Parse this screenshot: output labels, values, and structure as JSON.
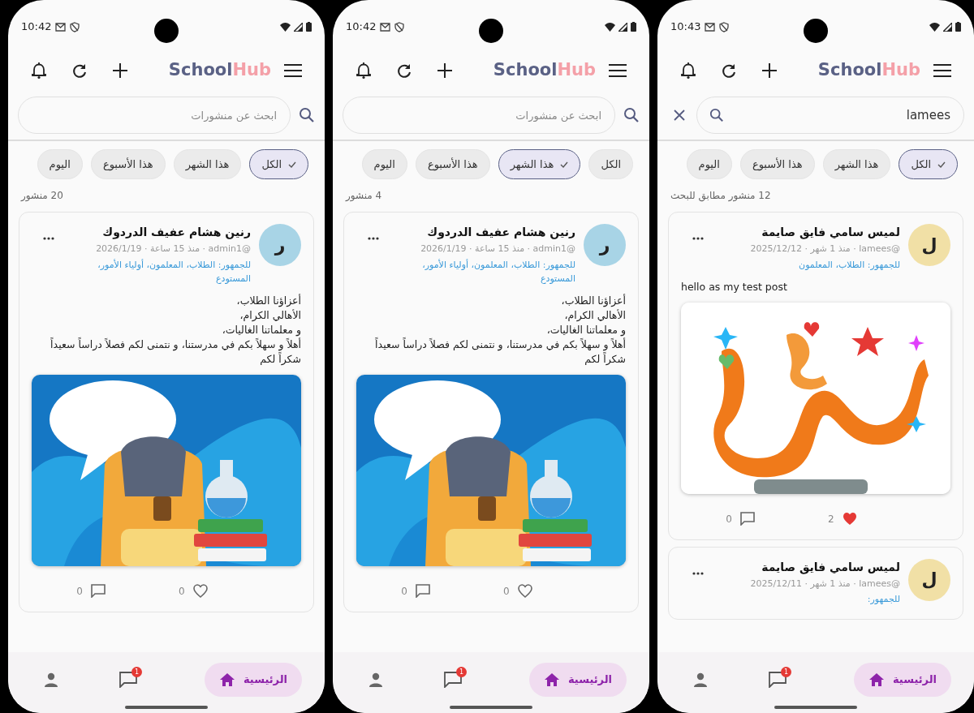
{
  "screens": [
    {
      "status": {
        "time": "10:43"
      },
      "logo": {
        "primary": "School",
        "accent": "Hub"
      },
      "search": {
        "kind": "active",
        "value": "lamees"
      },
      "filters": [
        {
          "label": "الكل",
          "selected": true
        },
        {
          "label": "هذا الشهر",
          "selected": false
        },
        {
          "label": "هذا الأسبوع",
          "selected": false
        },
        {
          "label": "اليوم",
          "selected": false
        }
      ],
      "count": "12 منشور مطابق للبحث",
      "posts": [
        {
          "avatar": "ل",
          "color": "#f1e0a6",
          "author": "لميس سامي فايق صايمة",
          "meta": "@lamees · منذ 1 شهر · 2025/12/12",
          "audience": "للجمهور: الطلاب، المعلمون",
          "body": "hello as my test post",
          "comments": "0",
          "likes": "2",
          "liked": true
        },
        {
          "avatar": "ل",
          "color": "#f1e0a6",
          "author": "لميس سامي فايق صايمة",
          "meta": "@lamees · منذ 1 شهر · 2025/12/11",
          "audience": "للجمهور:"
        }
      ],
      "nav": [
        {
          "kind": "home",
          "label": "الرئيسية",
          "selected": true
        },
        {
          "kind": "chat",
          "badge": "1",
          "selected": false
        },
        {
          "kind": "profile",
          "selected": false
        }
      ]
    },
    {
      "status": {
        "time": "10:42"
      },
      "logo": {
        "primary": "School",
        "accent": "Hub"
      },
      "search": {
        "kind": "idle",
        "placeholder": "ابحث عن منشورات"
      },
      "filters": [
        {
          "label": "الكل",
          "selected": false
        },
        {
          "label": "هذا الشهر",
          "selected": true
        },
        {
          "label": "هذا الأسبوع",
          "selected": false
        },
        {
          "label": "اليوم",
          "selected": false
        }
      ],
      "count": "4 منشور",
      "posts": [
        {
          "avatar": "ر",
          "color": "#a8d4e6",
          "author": "رنين هشام عفيف الدردوك",
          "meta": "@admin1 · منذ 15 ساعة · 2026/1/19",
          "audience": "للجمهور: الطلاب، المعلمون، أولياء الأمور، المستودع",
          "body": "أعزاؤنا الطلاب،\nالأهالي الكرام،\nو معلماتنا الغاليات،\nأهلاً و سهلاً بكم في مدرستنا، و نتمنى لكم فصلاً دراساً سعيداً\nشكراً لكم",
          "comments": "0",
          "likes": "0",
          "liked": false
        }
      ],
      "nav": [
        {
          "kind": "home",
          "label": "الرئيسية",
          "selected": true
        },
        {
          "kind": "chat",
          "badge": "1",
          "selected": false
        },
        {
          "kind": "profile",
          "selected": false
        }
      ]
    },
    {
      "status": {
        "time": "10:42"
      },
      "logo": {
        "primary": "School",
        "accent": "Hub"
      },
      "search": {
        "kind": "idle",
        "placeholder": "ابحث عن منشورات"
      },
      "filters": [
        {
          "label": "الكل",
          "selected": true
        },
        {
          "label": "هذا الشهر",
          "selected": false
        },
        {
          "label": "هذا الأسبوع",
          "selected": false
        },
        {
          "label": "اليوم",
          "selected": false
        }
      ],
      "count": "20 منشور",
      "posts": [
        {
          "avatar": "ر",
          "color": "#a8d4e6",
          "author": "رنين هشام عفيف الدردوك",
          "meta": "@admin1 · منذ 15 ساعة · 2026/1/19",
          "audience": "للجمهور: الطلاب، المعلمون، أولياء الأمور، المستودع",
          "body": "أعزاؤنا الطلاب،\nالأهالي الكرام،\nو معلماتنا الغاليات،\nأهلاً و سهلاً بكم في مدرستنا، و نتمنى لكم فصلاً دراساً سعيداً\nشكراً لكم",
          "comments": "0",
          "likes": "0",
          "liked": false
        }
      ],
      "nav": [
        {
          "kind": "home",
          "label": "الرئيسية",
          "selected": true
        },
        {
          "kind": "chat",
          "badge": "1",
          "selected": false
        },
        {
          "kind": "profile",
          "selected": false
        }
      ]
    }
  ]
}
